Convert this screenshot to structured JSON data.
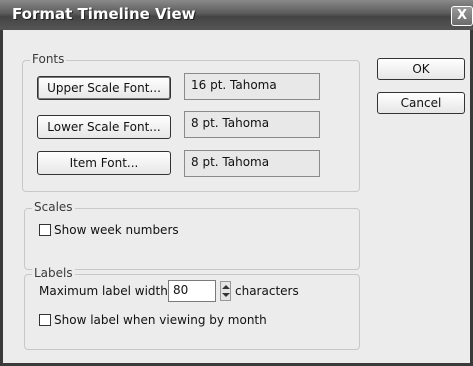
{
  "window": {
    "title": "Format Timeline View",
    "close_glyph": "X"
  },
  "buttons": {
    "ok": "OK",
    "cancel": "Cancel"
  },
  "fonts": {
    "legend": "Fonts",
    "upper_button": "Upper Scale Font...",
    "upper_value": "16 pt. Tahoma",
    "lower_button": "Lower Scale Font...",
    "lower_value": "8 pt. Tahoma",
    "item_button": "Item Font...",
    "item_value": "8 pt. Tahoma"
  },
  "scales": {
    "legend": "Scales",
    "show_week_numbers": "Show week numbers",
    "show_week_numbers_checked": false
  },
  "labels": {
    "legend": "Labels",
    "max_width_label": "Maximum label width:",
    "max_width_value": "80",
    "units": "characters",
    "show_label_by_month": "Show label when viewing by month",
    "show_label_by_month_checked": false
  }
}
